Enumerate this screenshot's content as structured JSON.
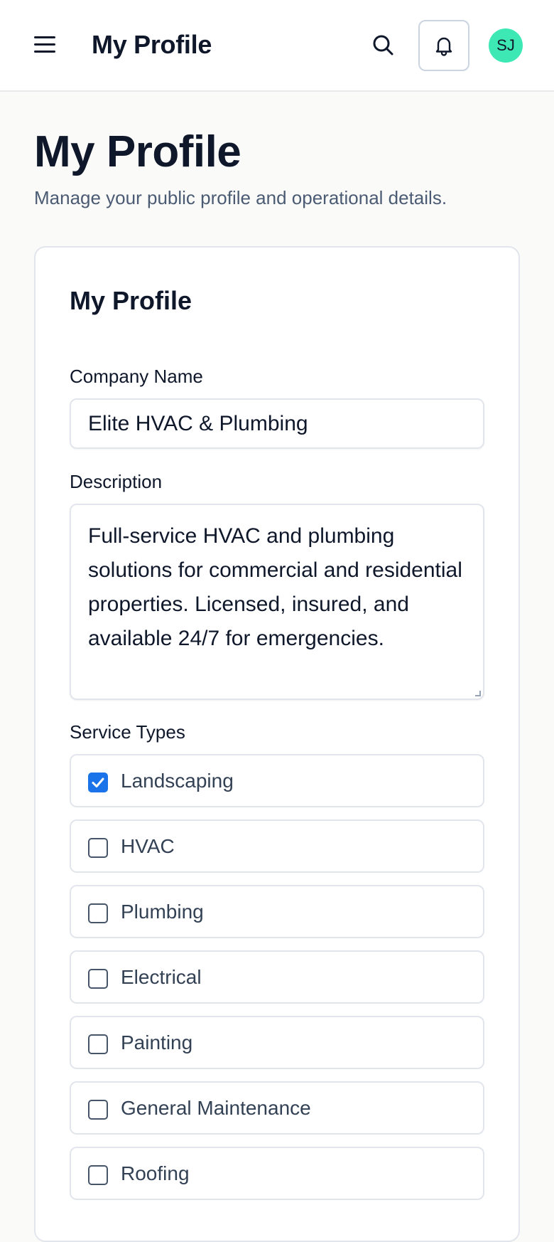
{
  "header": {
    "title": "My Profile",
    "avatar_initials": "SJ"
  },
  "page": {
    "title": "My Profile",
    "subtitle": "Manage your public profile and operational details."
  },
  "card": {
    "title": "My Profile",
    "company_name": {
      "label": "Company Name",
      "value": "Elite HVAC & Plumbing"
    },
    "description": {
      "label": "Description",
      "value": "Full-service HVAC and plumbing solutions for commercial and residential properties. Licensed, insured, and available 24/7 for emergencies."
    },
    "service_types": {
      "label": "Service Types",
      "items": [
        {
          "label": "Landscaping",
          "checked": true
        },
        {
          "label": "HVAC",
          "checked": false
        },
        {
          "label": "Plumbing",
          "checked": false
        },
        {
          "label": "Electrical",
          "checked": false
        },
        {
          "label": "Painting",
          "checked": false
        },
        {
          "label": "General Maintenance",
          "checked": false
        },
        {
          "label": "Roofing",
          "checked": false
        }
      ]
    }
  },
  "colors": {
    "accent": "#1A73E8",
    "avatar_bg": "#3DE8B5",
    "text_primary": "#0F172A",
    "text_secondary": "#4B5B73",
    "border": "#E2E6EC"
  },
  "icons": [
    "menu-icon",
    "search-icon",
    "bell-icon",
    "check-icon"
  ]
}
